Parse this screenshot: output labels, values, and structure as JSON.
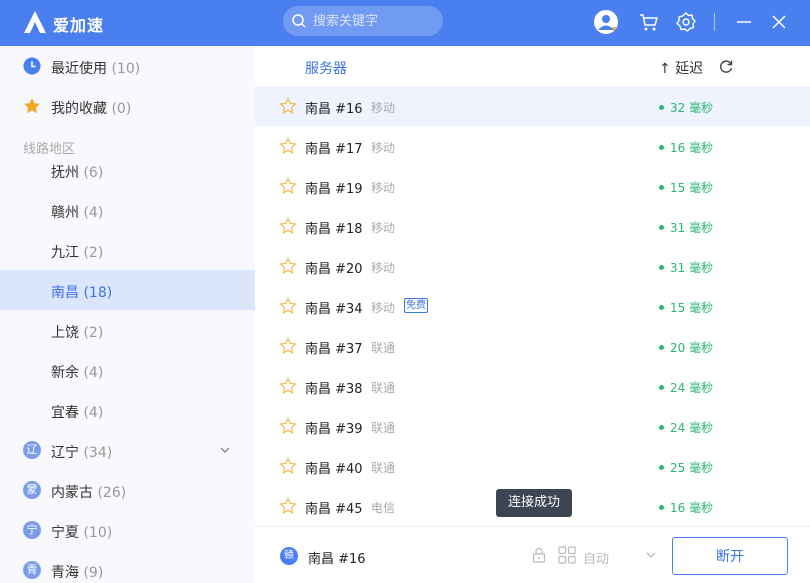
{
  "app": {
    "title": "爱加速"
  },
  "search": {
    "placeholder": "搜索关键字"
  },
  "colors": {
    "accent": "#4a7ff0",
    "latency_good": "#2bb673"
  },
  "sidebar": {
    "recent": {
      "label": "最近使用",
      "count": "(10)"
    },
    "favorites": {
      "label": "我的收藏",
      "count": "(0)"
    },
    "section_title": "线路地区",
    "cities": [
      {
        "label": "抚州",
        "count": "(6)"
      },
      {
        "label": "赣州",
        "count": "(4)"
      },
      {
        "label": "九江",
        "count": "(2)"
      },
      {
        "label": "南昌",
        "count": "(18)"
      },
      {
        "label": "上饶",
        "count": "(2)"
      },
      {
        "label": "新余",
        "count": "(4)"
      },
      {
        "label": "宜春",
        "count": "(4)"
      }
    ],
    "provinces": [
      {
        "badge": "辽",
        "label": "辽宁",
        "count": "(34)"
      },
      {
        "badge": "蒙",
        "label": "内蒙古",
        "count": "(26)"
      },
      {
        "badge": "宁",
        "label": "宁夏",
        "count": "(10)"
      },
      {
        "badge": "青",
        "label": "青海",
        "count": "(9)"
      }
    ]
  },
  "list": {
    "col_server": "服务器",
    "col_delay": "↑ 延迟",
    "rows": [
      {
        "name": "南昌 #16",
        "isp": "移动",
        "latency": "32 毫秒",
        "free": ""
      },
      {
        "name": "南昌 #17",
        "isp": "移动",
        "latency": "16 毫秒",
        "free": ""
      },
      {
        "name": "南昌 #19",
        "isp": "移动",
        "latency": "15 毫秒",
        "free": ""
      },
      {
        "name": "南昌 #18",
        "isp": "移动",
        "latency": "31 毫秒",
        "free": ""
      },
      {
        "name": "南昌 #20",
        "isp": "移动",
        "latency": "31 毫秒",
        "free": ""
      },
      {
        "name": "南昌 #34",
        "isp": "移动",
        "latency": "15 毫秒",
        "free": "免费"
      },
      {
        "name": "南昌 #37",
        "isp": "联通",
        "latency": "20 毫秒",
        "free": ""
      },
      {
        "name": "南昌 #38",
        "isp": "联通",
        "latency": "24 毫秒",
        "free": ""
      },
      {
        "name": "南昌 #39",
        "isp": "联通",
        "latency": "24 毫秒",
        "free": ""
      },
      {
        "name": "南昌 #40",
        "isp": "联通",
        "latency": "25 毫秒",
        "free": ""
      },
      {
        "name": "南昌 #45",
        "isp": "电信",
        "latency": "16 毫秒",
        "free": ""
      }
    ]
  },
  "toast": "连接成功",
  "footer": {
    "badge": "赣",
    "current_server": "南昌 #16",
    "mode": "自动",
    "disconnect": "断开"
  }
}
